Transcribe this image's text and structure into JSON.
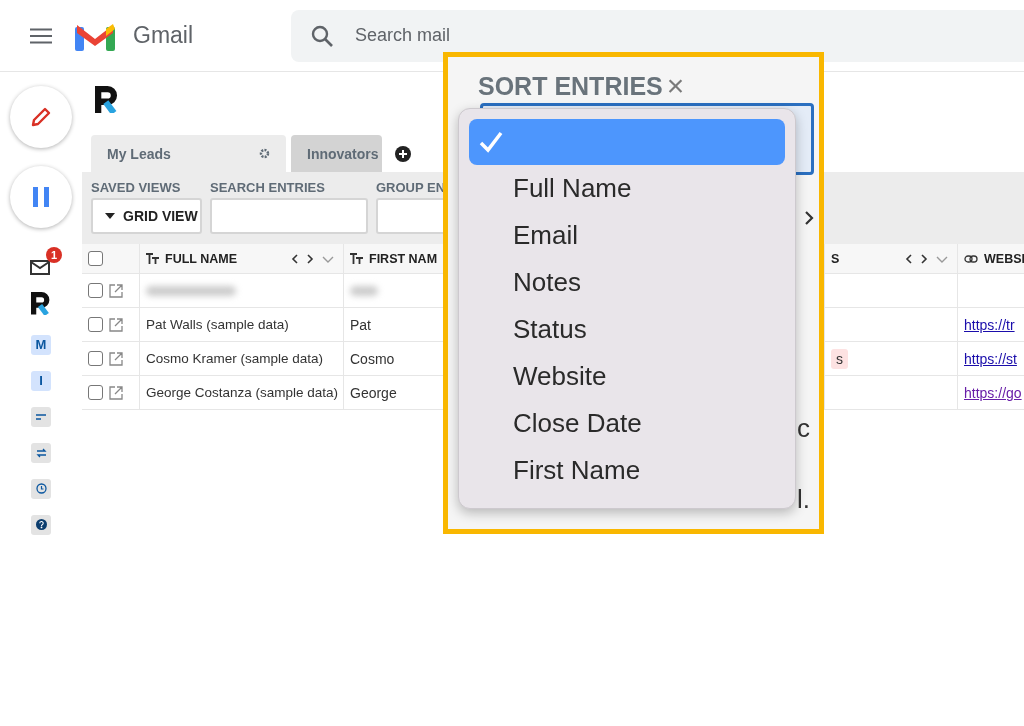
{
  "topbar": {
    "app_name": "Gmail",
    "search": {
      "placeholder": "Search mail"
    }
  },
  "rail": {
    "mail_badge": "1",
    "tiles": [
      {
        "kind": "letter",
        "label": "M"
      },
      {
        "kind": "letter",
        "label": "I"
      },
      {
        "kind": "lines"
      },
      {
        "kind": "repeat"
      },
      {
        "kind": "clock"
      },
      {
        "kind": "help"
      }
    ]
  },
  "tabs": [
    {
      "label": "My Leads",
      "selected": true
    },
    {
      "label": "Innovators",
      "selected": false
    }
  ],
  "toolbar": {
    "saved_views": {
      "label": "SAVED VIEWS",
      "value": "GRID VIEW"
    },
    "search_entries": {
      "label": "SEARCH ENTRIES"
    },
    "group_entries": {
      "label": "GROUP EN"
    }
  },
  "table": {
    "all_checked": false,
    "columns": [
      {
        "label": "FULL NAME",
        "kind": "text"
      },
      {
        "label": "FIRST NAM",
        "kind": "text"
      },
      {
        "label": "S",
        "kind": "tag"
      },
      {
        "label": "WEBSI",
        "kind": "link"
      }
    ],
    "rows": [
      {
        "checked": false,
        "blurred": true
      },
      {
        "checked": false,
        "blurred": false,
        "full_name": "Pat Walls (sample data)",
        "first_name": "Pat",
        "website": {
          "text": "https://tr",
          "visited": false
        }
      },
      {
        "checked": false,
        "blurred": false,
        "full_name": "Cosmo Kramer (sample data)",
        "first_name": "Cosmo",
        "tag": {
          "text": "s",
          "color": "#fde2e2"
        },
        "website": {
          "text": "https://st",
          "visited": false
        }
      },
      {
        "checked": false,
        "blurred": false,
        "full_name": "George Costanza (sample data)",
        "first_name": "George",
        "website": {
          "text": "https://go",
          "visited": true
        }
      }
    ]
  },
  "sort_panel": {
    "title": "SORT ENTRIES",
    "close": "×",
    "options": [
      {
        "selected": true
      },
      {
        "label": "Full Name",
        "selected": false
      },
      {
        "label": "Email",
        "selected": false
      },
      {
        "label": "Notes",
        "selected": false
      },
      {
        "label": "Status",
        "selected": false
      },
      {
        "label": "Website",
        "selected": false
      },
      {
        "label": "Close Date",
        "selected": false
      },
      {
        "label": "First Name",
        "selected": false
      }
    ],
    "background_fragments": [
      "c",
      "l."
    ]
  }
}
